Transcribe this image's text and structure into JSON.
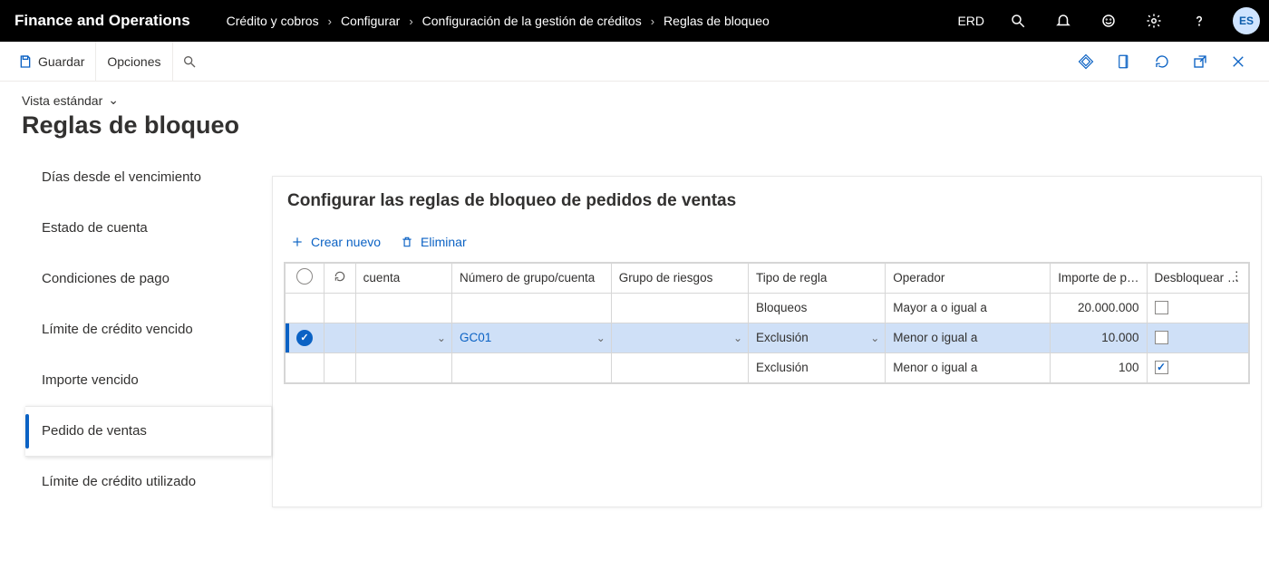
{
  "top": {
    "brand": "Finance and Operations",
    "breadcrumbs": [
      "Crédito y cobros",
      "Configurar",
      "Configuración de la gestión de créditos",
      "Reglas de bloqueo"
    ],
    "entity_label": "ERD",
    "avatar_initials": "ES"
  },
  "action_bar": {
    "save": "Guardar",
    "options": "Opciones"
  },
  "page": {
    "view_label": "Vista estándar",
    "title": "Reglas de bloqueo"
  },
  "left_nav": {
    "items": [
      {
        "label": "Días desde el vencimiento",
        "selected": false
      },
      {
        "label": "Estado de cuenta",
        "selected": false
      },
      {
        "label": "Condiciones de pago",
        "selected": false
      },
      {
        "label": "Límite de crédito vencido",
        "selected": false
      },
      {
        "label": "Importe vencido",
        "selected": false
      },
      {
        "label": "Pedido de ventas",
        "selected": true
      },
      {
        "label": "Límite de crédito utilizado",
        "selected": false
      }
    ]
  },
  "card": {
    "title": "Configurar las reglas de bloqueo de pedidos de ventas",
    "create_label": "Crear nuevo",
    "delete_label": "Eliminar"
  },
  "grid": {
    "columns": {
      "account": "cuenta",
      "group_number": "Número de grupo/cuenta",
      "risk_group": "Grupo de riesgos",
      "rule_type": "Tipo de regla",
      "operator": "Operador",
      "amount": "Importe de pe...",
      "unblock": "Desbloquear p..."
    },
    "rows": [
      {
        "selected": false,
        "account": "",
        "group": "",
        "risk": "",
        "rule_type": "Bloqueos",
        "operator": "Mayor a o igual a",
        "amount": "20.000.000",
        "unblock": false
      },
      {
        "selected": true,
        "account": "",
        "group": "GC01",
        "risk": "",
        "rule_type": "Exclusión",
        "operator": "Menor o igual a",
        "amount": "10.000",
        "unblock": false
      },
      {
        "selected": false,
        "account": "",
        "group": "",
        "risk": "",
        "rule_type": "Exclusión",
        "operator": "Menor o igual a",
        "amount": "100",
        "unblock": true
      }
    ]
  }
}
